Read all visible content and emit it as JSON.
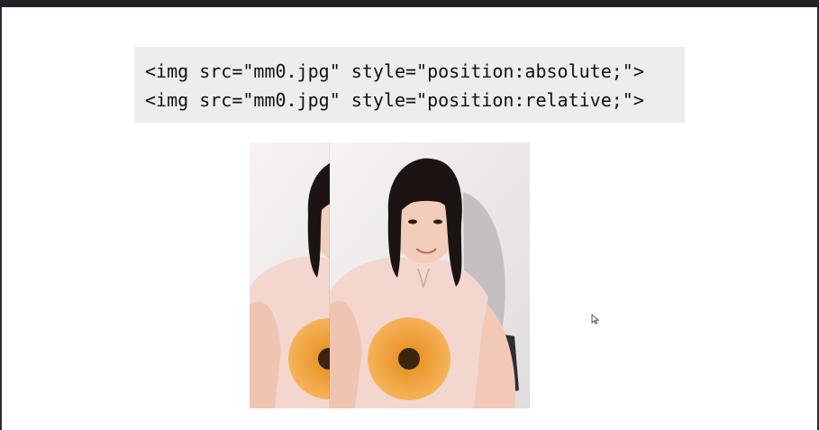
{
  "code": {
    "line1": "<img src=\"mm0.jpg\" style=\"position:absolute;\">",
    "line2": "<img src=\"mm0.jpg\" style=\"position:relative;\">"
  },
  "colors": {
    "code_background": "#ededed",
    "top_bar": "#1f2226",
    "page_background": "#ffffff"
  }
}
